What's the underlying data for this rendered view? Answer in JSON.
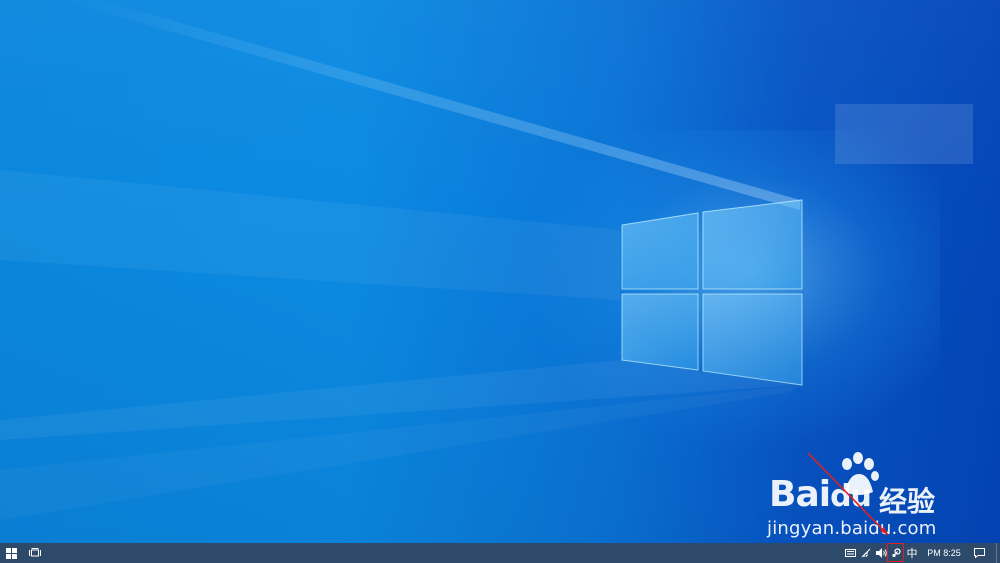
{
  "taskbar": {
    "start_icon": "windows-logo-icon",
    "task_view_icon": "task-view-icon",
    "tray": {
      "icons": [
        "keyboard-icon",
        "network-icon",
        "volume-icon",
        "steam-icon"
      ],
      "ime_indicator": "中",
      "clock": "PM 8:25",
      "notification_icon": "action-center-icon"
    }
  },
  "watermark": {
    "brand": "Bai",
    "brand_suffix": "du",
    "cn_text": "经验",
    "url": "jingyan.baidu.com"
  },
  "annotations": {
    "highlight_color": "#e02020"
  },
  "colors": {
    "wallpaper_left": "#0a86dd",
    "wallpaper_right": "#0346b8",
    "taskbar": "#2d4a6b"
  }
}
